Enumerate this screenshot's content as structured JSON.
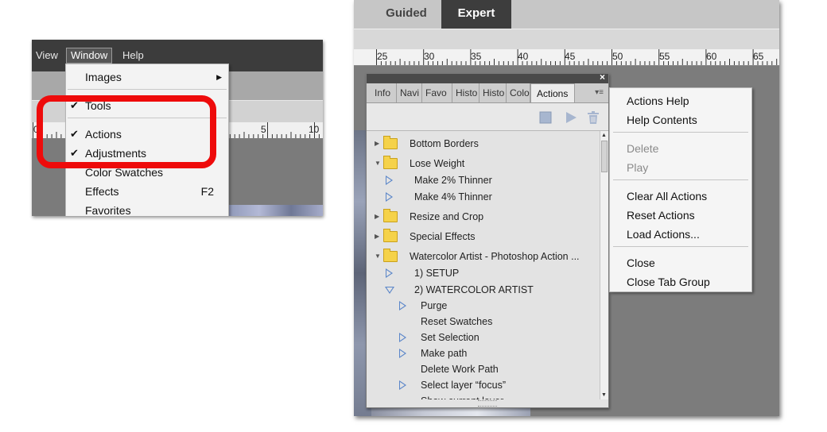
{
  "left_screenshot": {
    "menubar": {
      "view": "View",
      "window": "Window",
      "help": "Help"
    },
    "ruler": {
      "ticks": [
        "0",
        "5",
        "10"
      ]
    },
    "window_menu": {
      "items": [
        {
          "label": "Images",
          "checked": false,
          "submenu": true
        },
        {
          "label": "Tools",
          "checked": true
        },
        {
          "label": "Actions",
          "checked": true
        },
        {
          "label": "Adjustments",
          "checked": true
        },
        {
          "label": "Color Swatches",
          "checked": false
        },
        {
          "label": "Effects",
          "checked": false,
          "shortcut": "F2"
        },
        {
          "label": "Favorites",
          "checked": false
        }
      ],
      "check_glyph": "✔",
      "submenu_arrow": "▶"
    },
    "highlight_color": "#ee0b0b"
  },
  "right_screenshot": {
    "mode_tabs": {
      "guided": "Guided",
      "expert": "Expert"
    },
    "ruler": {
      "ticks": [
        "25",
        "30",
        "35",
        "40",
        "45",
        "50",
        "55",
        "60",
        "65"
      ]
    },
    "panel": {
      "close_glyph": "×",
      "tabs": [
        "Info",
        "Navi",
        "Favo",
        "Histo",
        "Histo",
        "Colo",
        "Actions"
      ],
      "menu_glyph": "▾≡",
      "actions": [
        {
          "type": "folder",
          "label": "Bottom Borders",
          "expanded": false
        },
        {
          "type": "folder",
          "label": "Lose Weight",
          "expanded": true
        },
        {
          "type": "action",
          "label": "Make 2% Thinner",
          "expanded": false
        },
        {
          "type": "action",
          "label": "Make 4% Thinner",
          "expanded": false
        },
        {
          "type": "folder",
          "label": "Resize and Crop",
          "expanded": false
        },
        {
          "type": "folder",
          "label": "Special Effects",
          "expanded": false
        },
        {
          "type": "folder",
          "label": "Watercolor Artist - Photoshop Action ...",
          "expanded": true
        },
        {
          "type": "action",
          "label": "1) SETUP",
          "expanded": false
        },
        {
          "type": "action",
          "label": "2) WATERCOLOR ARTIST",
          "expanded": true
        },
        {
          "type": "step",
          "label": "Purge",
          "expandable": true
        },
        {
          "type": "step",
          "label": "Reset Swatches",
          "expandable": false
        },
        {
          "type": "step",
          "label": "Set Selection",
          "expandable": true
        },
        {
          "type": "step",
          "label": "Make path",
          "expandable": true
        },
        {
          "type": "step",
          "label": "Delete Work Path",
          "expandable": false
        },
        {
          "type": "step",
          "label": "Select layer “focus”",
          "expandable": true
        },
        {
          "type": "step",
          "label": "Show current layer",
          "expandable": false
        }
      ]
    },
    "flyout_menu": {
      "groups": [
        [
          {
            "label": "Actions Help",
            "enabled": true
          },
          {
            "label": "Help Contents",
            "enabled": true
          }
        ],
        [
          {
            "label": "Delete",
            "enabled": false
          },
          {
            "label": "Play",
            "enabled": false
          }
        ],
        [
          {
            "label": "Clear All Actions",
            "enabled": true
          },
          {
            "label": "Reset Actions",
            "enabled": true
          },
          {
            "label": "Load Actions...",
            "enabled": true
          }
        ],
        [
          {
            "label": "Close",
            "enabled": true
          },
          {
            "label": "Close Tab Group",
            "enabled": true
          }
        ]
      ]
    }
  }
}
